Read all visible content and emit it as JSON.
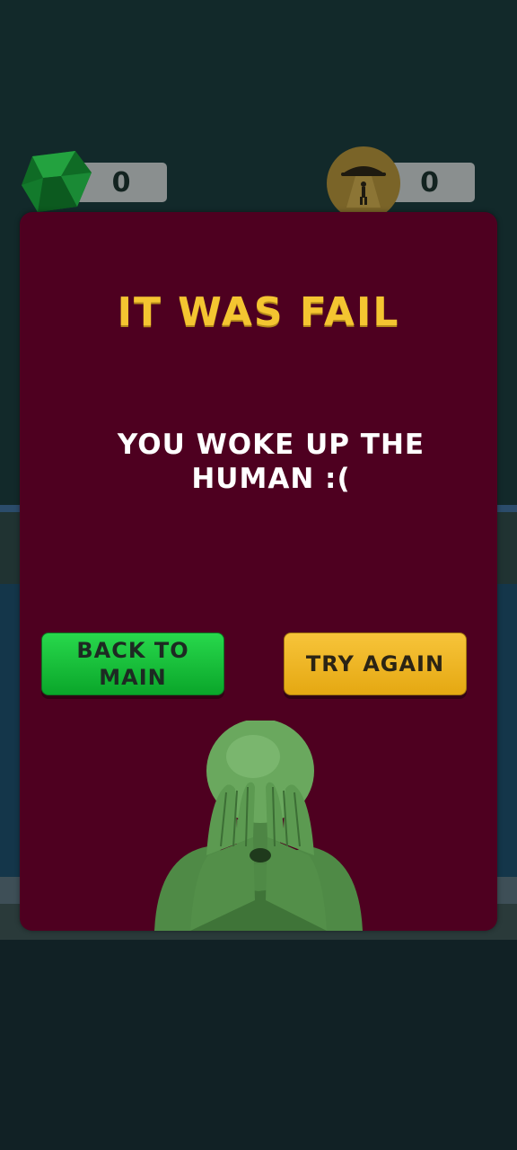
{
  "hud": {
    "gems_count": "0",
    "abductions_count": "0"
  },
  "modal": {
    "title": "IT WAS FAIL",
    "message": "YOU WOKE UP THE HUMAN :(",
    "back_button_label": "BACK TO MAIN",
    "try_again_label": "TRY AGAIN"
  },
  "icons": {
    "gem": "emerald-gem-icon",
    "abduction": "ufo-abduction-icon",
    "character": "alien-covering-face"
  },
  "colors": {
    "modal_bg": "#4e0020",
    "title": "#f4c531",
    "back_button": "#15c03a",
    "try_button": "#f0b825"
  }
}
